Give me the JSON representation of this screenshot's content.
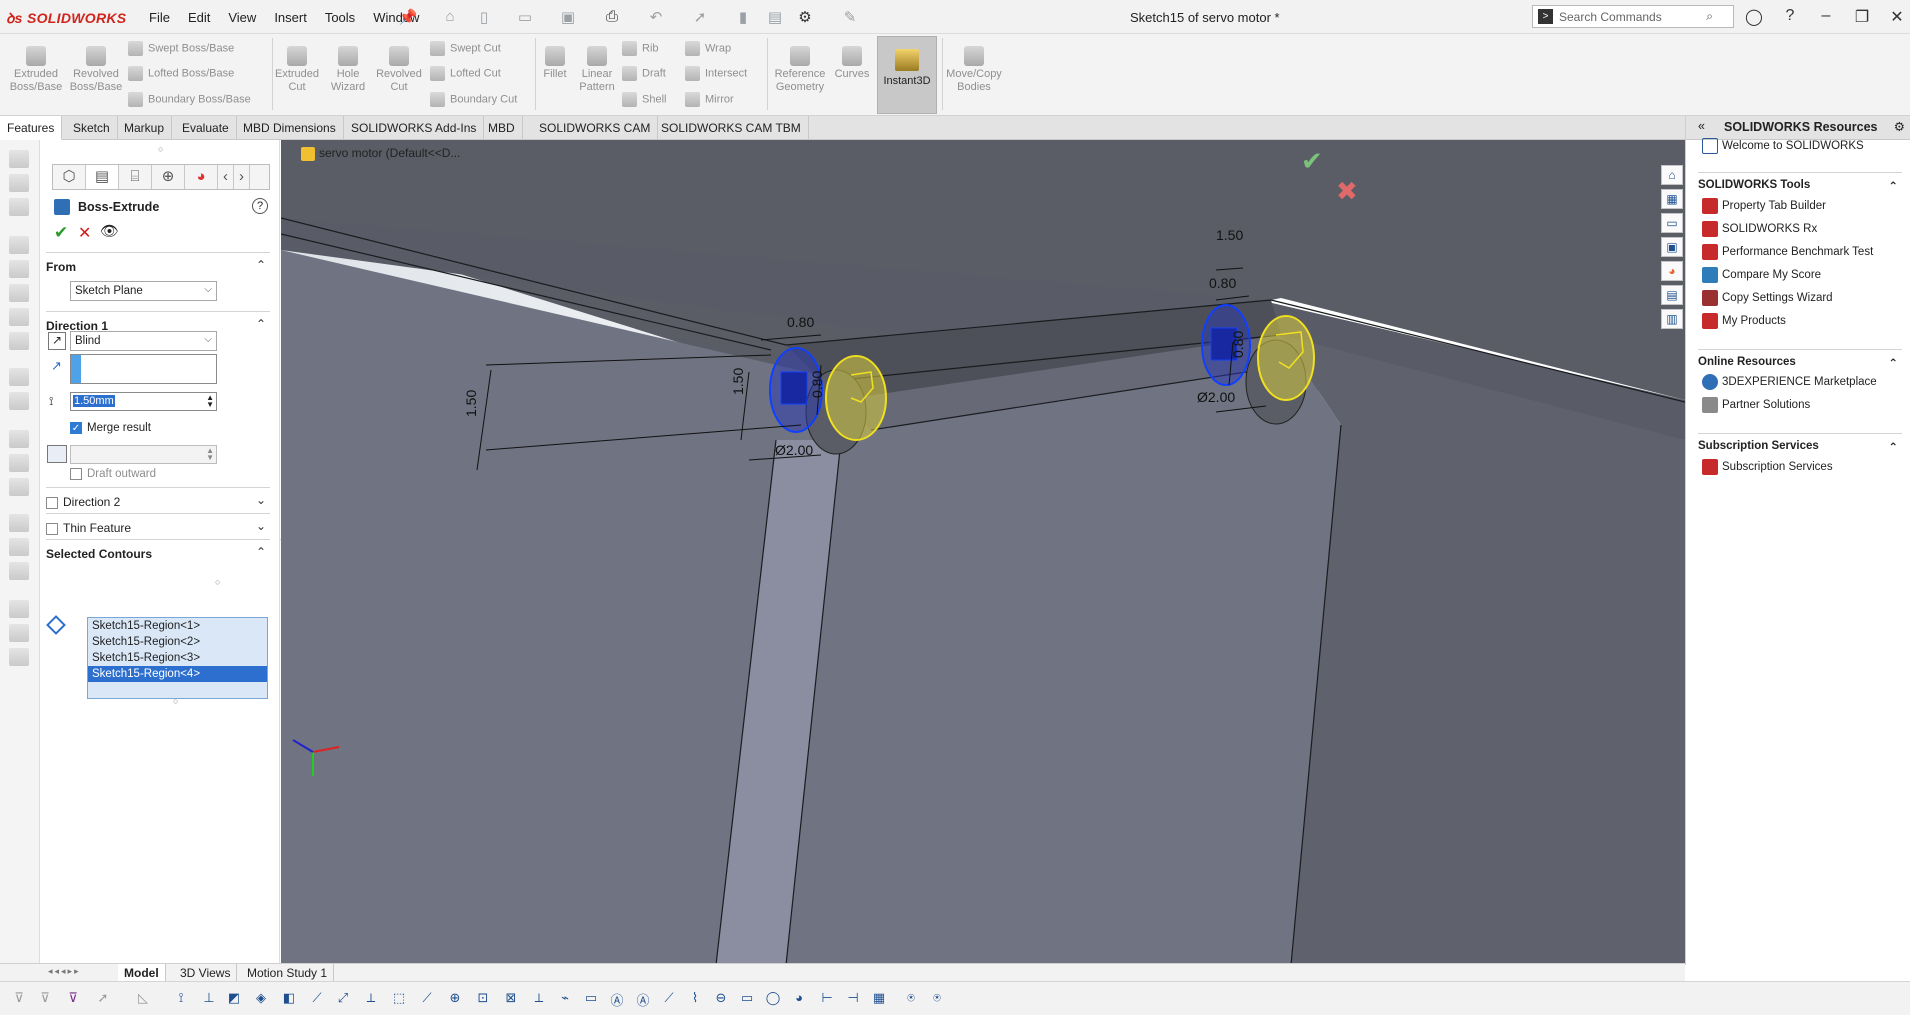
{
  "app": {
    "logo": "SOLIDWORKS",
    "document_title": "Sketch15 of servo motor *",
    "menu": [
      "File",
      "Edit",
      "View",
      "Insert",
      "Tools",
      "Window"
    ],
    "search_placeholder": "Search Commands"
  },
  "command_manager": {
    "buttons": {
      "extruded_boss": "Extruded Boss/Base",
      "revolved_boss": "Revolved Boss/Base",
      "swept_boss": "Swept Boss/Base",
      "lofted_boss": "Lofted Boss/Base",
      "boundary_boss": "Boundary Boss/Base",
      "extruded_cut": "Extruded Cut",
      "hole_wizard": "Hole Wizard",
      "revolved_cut": "Revolved Cut",
      "swept_cut": "Swept Cut",
      "lofted_cut": "Lofted Cut",
      "boundary_cut": "Boundary Cut",
      "fillet": "Fillet",
      "linear_pattern": "Linear Pattern",
      "rib": "Rib",
      "draft": "Draft",
      "shell": "Shell",
      "wrap": "Wrap",
      "intersect": "Intersect",
      "mirror": "Mirror",
      "reference_geometry": "Reference Geometry",
      "curves": "Curves",
      "instant3d": "Instant3D",
      "move_copy": "Move/Copy Bodies"
    },
    "tabs": [
      "Features",
      "Sketch",
      "Markup",
      "Evaluate",
      "MBD Dimensions",
      "SOLIDWORKS Add-Ins",
      "MBD",
      "SOLIDWORKS CAM",
      "SOLIDWORKS CAM TBM"
    ],
    "active_tab": "Features"
  },
  "property_manager": {
    "title": "Boss-Extrude",
    "from": {
      "label": "From",
      "value": "Sketch Plane"
    },
    "direction1": {
      "label": "Direction 1",
      "end_condition": "Blind",
      "depth": "1.50mm",
      "merge_result": "Merge result",
      "draft_outward": "Draft outward"
    },
    "direction2": {
      "label": "Direction 2"
    },
    "thin_feature": {
      "label": "Thin Feature"
    },
    "selected_contours": {
      "label": "Selected Contours",
      "items": [
        "Sketch15-Region<1>",
        "Sketch15-Region<2>",
        "Sketch15-Region<3>",
        "Sketch15-Region<4>"
      ]
    }
  },
  "viewport": {
    "tree_flyout": "servo motor  (Default<<D...",
    "dimensions": {
      "d150_left": "1.50",
      "d080_top_left": "0.80",
      "d150_circle_left": "1.50",
      "d080_vert_left": "0.80",
      "diam_left": "Ø2.00",
      "d150_right": "1.50",
      "d080_top_right": "0.80",
      "d080_vert_right": "0.80",
      "diam_right": "Ø2.00"
    },
    "colors": {
      "sketch_blue": "#1040ff",
      "preview_yellow": "#f0e020",
      "body_dark": "#5a5d66",
      "body_mid": "#6c7180"
    }
  },
  "task_pane": {
    "title": "SOLIDWORKS Resources",
    "welcome": "Welcome to SOLIDWORKS",
    "tools_title": "SOLIDWORKS Tools",
    "tools": [
      "Property Tab Builder",
      "SOLIDWORKS Rx",
      "Performance Benchmark Test",
      "Compare My Score",
      "Copy Settings Wizard",
      "My Products"
    ],
    "online_title": "Online Resources",
    "online": [
      "3DEXPERIENCE Marketplace",
      "Partner Solutions"
    ],
    "subs_title": "Subscription Services",
    "subs": [
      "Subscription Services"
    ]
  },
  "bottom_tabs": [
    "Model",
    "3D Views",
    "Motion Study 1"
  ],
  "active_bottom_tab": "Model"
}
